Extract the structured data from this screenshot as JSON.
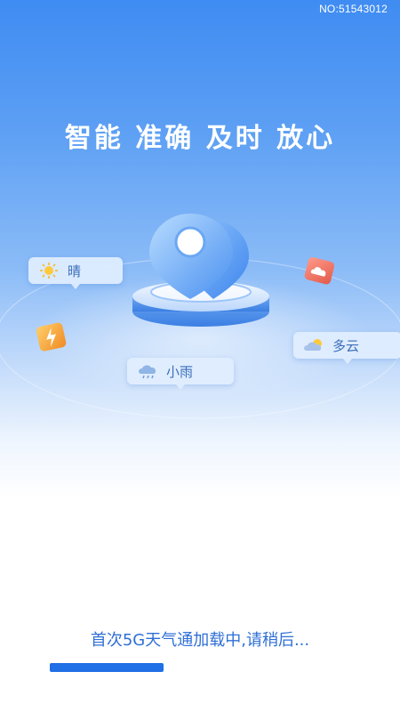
{
  "watermark": "NO:51543012",
  "slogan": "智能 准确 及时 放心",
  "tags": {
    "sunny": {
      "label": "晴",
      "icon": "sun-icon"
    },
    "light_rain": {
      "label": "小雨",
      "icon": "rain-cloud-icon"
    },
    "cloudy": {
      "label": "多云",
      "icon": "partly-cloudy-icon"
    }
  },
  "floating_icons": [
    "lightning-badge-icon",
    "cloud-badge-icon"
  ],
  "loading": {
    "text": "首次5G天气通加载中,请稍后...",
    "progress": 0.38
  },
  "colors": {
    "accent": "#1f6fe6",
    "loading_text": "#2f6fd6",
    "sky_top": "#3f8cf2"
  }
}
